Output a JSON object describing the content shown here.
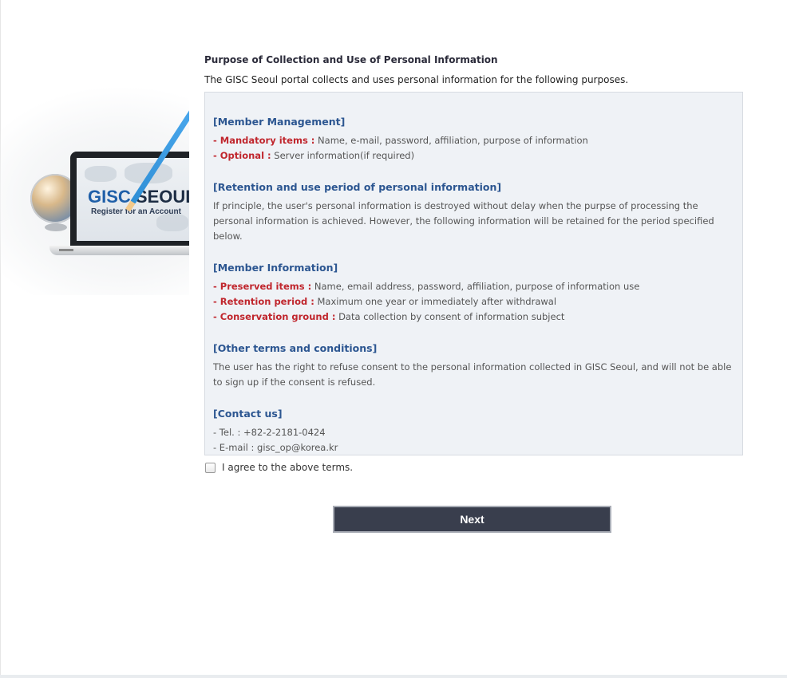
{
  "hero": {
    "logo_gisc": "GISC",
    "logo_seoul": " SEOUL",
    "logo_sub": "Register for an Account"
  },
  "header": {
    "title": "Purpose of Collection and Use of Personal Information",
    "subtitle": "The GISC Seoul portal collects and uses personal information for the following purposes."
  },
  "terms": {
    "member_management": {
      "title": "[Member Management]",
      "items": [
        {
          "label": "- Mandatory items :",
          "value": " Name, e-mail, password, affiliation, purpose of information"
        },
        {
          "label": "- Optional :",
          "value": " Server information(if required)"
        }
      ]
    },
    "retention": {
      "title": "[Retention and use period of personal information]",
      "text": "If principle, the user's personal information is destroyed without delay when the purpse of processing the personal information is achieved. However, the following information will be retained for the period specified below."
    },
    "member_information": {
      "title": "[Member Information]",
      "items": [
        {
          "label": "- Preserved items :",
          "value": " Name, email address, password, affiliation, purpose of information use"
        },
        {
          "label": "- Retention period :",
          "value": " Maximum one year or immediately after withdrawal"
        },
        {
          "label": "- Conservation ground :",
          "value": " Data collection by consent of information subject"
        }
      ]
    },
    "other_terms": {
      "title": "[Other terms and conditions]",
      "text": "The user has the right to refuse consent to the personal information collected in GISC Seoul, and will not be able to sign up if the consent is refused."
    },
    "contact": {
      "title": "[Contact us]",
      "tel": "- Tel. : +82-2-2181-0424",
      "email": "- E-mail : gisc_op@korea.kr"
    }
  },
  "agree": {
    "label": "I agree to the above terms.",
    "checked": false
  },
  "next_button": "Next",
  "colors": {
    "section_title": "#2c5691",
    "key_label": "#c0262d",
    "button_bg": "#393e4d",
    "box_bg": "#eff2f6"
  }
}
